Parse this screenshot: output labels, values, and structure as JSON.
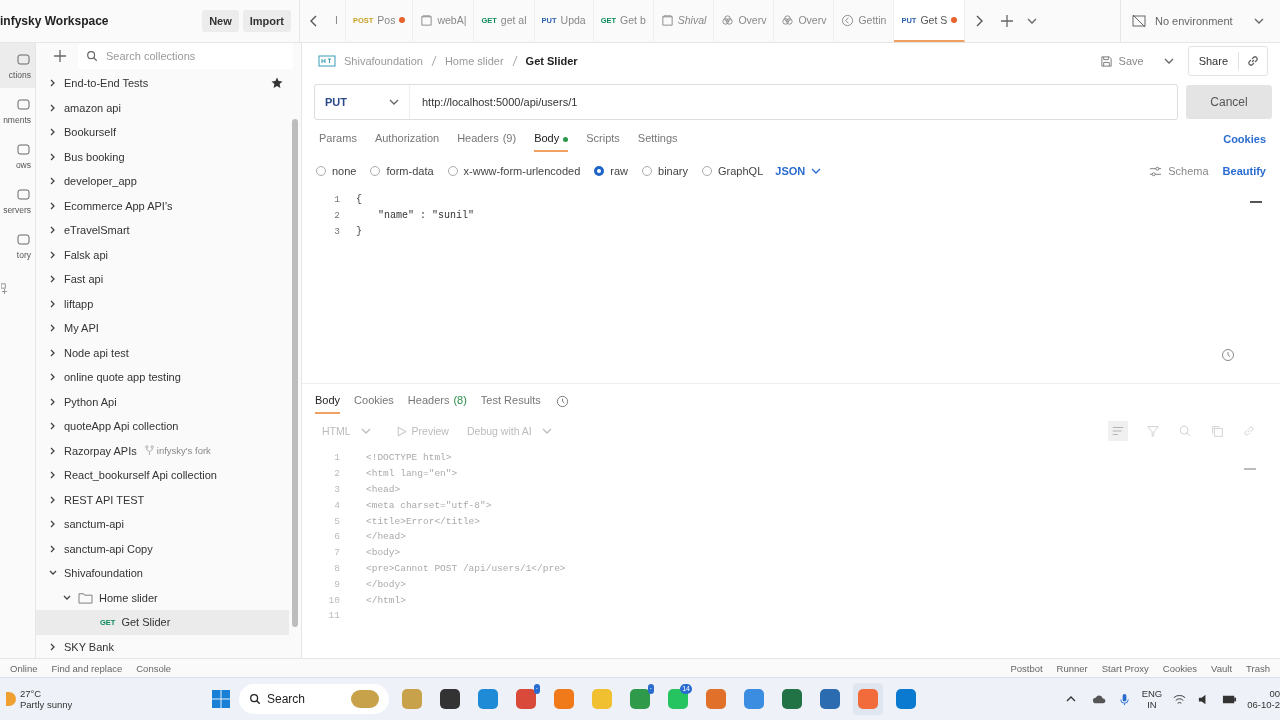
{
  "workspace": {
    "title": "infysky Workspace",
    "buttons": [
      "New",
      "Import"
    ]
  },
  "tabs": [
    {
      "kind": "request",
      "label": "I",
      "selected": false,
      "dirty": false
    },
    {
      "kind": "request",
      "method": "POST",
      "label": "Pos",
      "selected": false,
      "dirty": true
    },
    {
      "kind": "collection",
      "label": "webA|",
      "selected": false,
      "dirty": false
    },
    {
      "kind": "request",
      "method": "GET",
      "label": "get al",
      "selected": false,
      "dirty": false
    },
    {
      "kind": "request",
      "method": "PUT",
      "label": "Upda",
      "selected": false,
      "dirty": false
    },
    {
      "kind": "request",
      "method": "GET",
      "label": "Get b",
      "selected": false,
      "dirty": false
    },
    {
      "kind": "collection",
      "label": "Shival",
      "selected": false,
      "dirty": false
    },
    {
      "kind": "overview",
      "label": "Overv",
      "selected": false,
      "dirty": false
    },
    {
      "kind": "overview",
      "label": "Overv",
      "selected": false,
      "dirty": false
    },
    {
      "kind": "guide",
      "label": "Gettin",
      "selected": false,
      "dirty": false
    },
    {
      "kind": "request",
      "method": "PUT",
      "label": "Get S",
      "selected": true,
      "dirty": true
    }
  ],
  "environment": "No environment",
  "rail": [
    {
      "label": "ctions",
      "selected": true
    },
    {
      "label": "nments",
      "selected": false
    },
    {
      "label": "ows",
      "selected": false
    },
    {
      "label": "servers",
      "selected": false
    },
    {
      "label": "tory",
      "selected": false
    }
  ],
  "sidebar": {
    "search_placeholder": "Search collections",
    "items": [
      {
        "label": "End-to-End Tests",
        "starred": true,
        "expanded": false
      },
      {
        "label": "amazon api",
        "expanded": false
      },
      {
        "label": "Bookurself",
        "expanded": false
      },
      {
        "label": "Bus booking",
        "expanded": false
      },
      {
        "label": "developer_app",
        "expanded": false
      },
      {
        "label": "Ecommerce App API's",
        "expanded": false
      },
      {
        "label": "eTravelSmart",
        "expanded": false
      },
      {
        "label": "Falsk api",
        "expanded": false
      },
      {
        "label": "Fast api",
        "expanded": false
      },
      {
        "label": "liftapp",
        "expanded": false
      },
      {
        "label": "My API",
        "expanded": false
      },
      {
        "label": "Node api test",
        "expanded": false
      },
      {
        "label": "online quote app testing",
        "expanded": false
      },
      {
        "label": "Python Api",
        "expanded": false
      },
      {
        "label": "quoteApp Api collection",
        "expanded": false
      },
      {
        "label": "Razorpay APIs",
        "fork": "infysky's fork",
        "expanded": false
      },
      {
        "label": "React_bookurself Api collection",
        "expanded": false
      },
      {
        "label": "REST API TEST",
        "expanded": false
      },
      {
        "label": "sanctum-api",
        "expanded": false
      },
      {
        "label": "sanctum-api Copy",
        "expanded": false
      },
      {
        "label": "Shivafoundation",
        "expanded": true,
        "children": [
          {
            "kind": "folder",
            "label": "Home slider",
            "expanded": true,
            "children": [
              {
                "kind": "request",
                "method": "GET",
                "label": "Get Slider",
                "selected": true
              }
            ]
          }
        ]
      },
      {
        "label": "SKY Bank",
        "expanded": false
      }
    ]
  },
  "breadcrumb": [
    "Shivafoundation",
    "Home slider",
    "Get Slider"
  ],
  "actions": {
    "save": "Save",
    "share": "Share"
  },
  "request": {
    "method": "PUT",
    "url": "http://localhost:5000/api/users/1",
    "send": "Cancel"
  },
  "request_tabs": [
    {
      "label": "Params",
      "selected": false
    },
    {
      "label": "Authorization",
      "selected": false
    },
    {
      "label": "Headers",
      "count": "(9)",
      "selected": false
    },
    {
      "label": "Body",
      "dot": true,
      "selected": true
    },
    {
      "label": "Scripts",
      "selected": false
    },
    {
      "label": "Settings",
      "selected": false
    }
  ],
  "cookies_link": "Cookies",
  "body_types": [
    {
      "label": "none",
      "selected": false
    },
    {
      "label": "form-data",
      "selected": false
    },
    {
      "label": "x-www-form-urlencoded",
      "selected": false
    },
    {
      "label": "raw",
      "selected": true
    },
    {
      "label": "binary",
      "selected": false
    },
    {
      "label": "GraphQL",
      "selected": false
    }
  ],
  "body_format": "JSON",
  "schema": "Schema",
  "beautify": "Beautify",
  "body_lines": [
    {
      "number": "1",
      "text": "{"
    },
    {
      "number": "2",
      "text": "\"name\" : \"sunil\""
    },
    {
      "number": "3",
      "text": "}"
    }
  ],
  "response_tabs": [
    {
      "label": "Body",
      "selected": true
    },
    {
      "label": "Cookies",
      "selected": false
    },
    {
      "label": "Headers",
      "count": "(8)",
      "selected": false
    },
    {
      "label": "Test Results",
      "selected": false
    }
  ],
  "response_toolbar": {
    "format": "HTML",
    "preview": "Preview",
    "debug": "Debug with AI"
  },
  "response_lines": [
    {
      "number": "1",
      "text": "<!DOCTYPE html>"
    },
    {
      "number": "2",
      "text": "<html lang=\"en\">"
    },
    {
      "number": "3",
      "text": "<head>"
    },
    {
      "number": "4",
      "text": "<meta charset=\"utf-8\">"
    },
    {
      "number": "5",
      "text": "<title>Error</title>"
    },
    {
      "number": "6",
      "text": "</head>"
    },
    {
      "number": "7",
      "text": "<body>"
    },
    {
      "number": "8",
      "text": "<pre>Cannot POST /api/users/1</pre>"
    },
    {
      "number": "9",
      "text": "</body>"
    },
    {
      "number": "10",
      "text": "</html>"
    },
    {
      "number": "11"
    }
  ],
  "status_left": [
    "Online",
    "Find and replace",
    "Console"
  ],
  "status_right": [
    "Postbot",
    "Runner",
    "Start Proxy",
    "Cookies",
    "Vault",
    "Trash"
  ],
  "taskbar": {
    "temperature": "27°C",
    "weather": "Partly sunny",
    "search": "Search",
    "apps": [
      {
        "color": "#c8a24a"
      },
      {
        "color": "#333333"
      },
      {
        "color": "#1f8ad6"
      },
      {
        "color": "#d94a3a",
        "badge": "·"
      },
      {
        "color": "#f07a1a"
      },
      {
        "color": "#f0c030"
      },
      {
        "color": "#2f9a4a",
        "badge": "·"
      },
      {
        "color": "#25c460",
        "badge": "14"
      },
      {
        "color": "#e0702a"
      },
      {
        "color": "#3a8de0"
      },
      {
        "color": "#217346"
      },
      {
        "color": "#2b6cb0"
      },
      {
        "color": "#f26b3a",
        "active": true
      },
      {
        "color": "#0a7ad1"
      }
    ],
    "language": "ENG",
    "region": "IN",
    "time": "00",
    "date": "06-10-2"
  }
}
